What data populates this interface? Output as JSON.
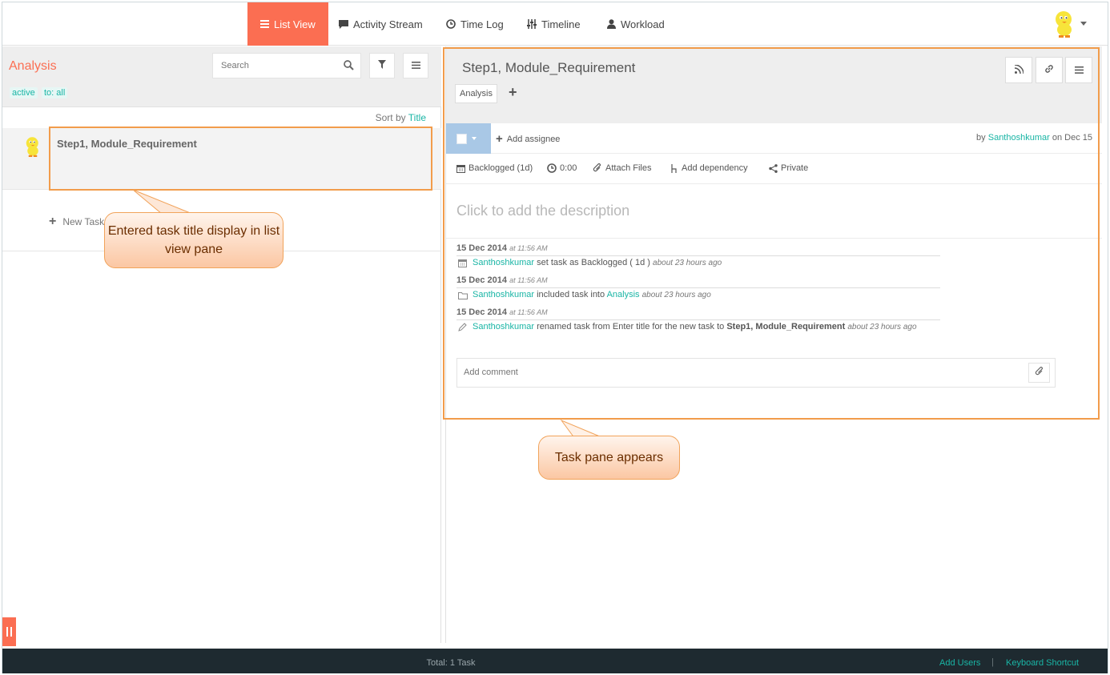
{
  "nav": {
    "list_view": "List View",
    "activity_stream": "Activity Stream",
    "time_log": "Time Log",
    "timeline": "Timeline",
    "workload": "Workload"
  },
  "list_pane": {
    "title": "Analysis",
    "filter_active": "active",
    "filter_to": "to: all",
    "search_placeholder": "Search",
    "sort_prefix": "Sort by",
    "sort_field": "Title",
    "task_title": "Step1, Module_Requirement",
    "new_task": "New Task"
  },
  "task_pane": {
    "title": "Step1, Module_Requirement",
    "tag": "Analysis",
    "add_assignee": "Add assignee",
    "by_label": "by",
    "author": "Santhoshkumar",
    "on_date": "on Dec 15",
    "status": "Backlogged (1d)",
    "time": "0:00",
    "attach_files": "Attach Files",
    "add_dependency": "Add dependency",
    "privacy": "Private",
    "description_placeholder": "Click to add the description",
    "comment_placeholder": "Add comment",
    "activities": [
      {
        "date": "15 Dec 2014",
        "time": "at 11:56 AM",
        "user": "Santhoshkumar",
        "text": "set task as Backlogged ( 1d )",
        "ago": "about 23 hours ago"
      },
      {
        "date": "15 Dec 2014",
        "time": "at 11:56 AM",
        "user": "Santhoshkumar",
        "text": "included task into",
        "target": "Analysis",
        "ago": "about 23 hours ago"
      },
      {
        "date": "15 Dec 2014",
        "time": "at 11:56 AM",
        "user": "Santhoshkumar",
        "text": "renamed task from Enter title for the new task to",
        "target": "Step1, Module_Requirement",
        "ago": "about 23 hours ago"
      }
    ]
  },
  "callouts": {
    "list_callout": "Entered task title display in list view pane",
    "task_callout": "Task pane appears"
  },
  "footer": {
    "total": "Total: 1 Task",
    "add_users": "Add Users",
    "separator": "|",
    "keyboard_shortcut": "Keyboard Shortcut"
  },
  "colors": {
    "accent": "#fb6e52",
    "link": "#19b5a5",
    "highlight": "#f29c4b",
    "footer_bg": "#1e2a30"
  }
}
